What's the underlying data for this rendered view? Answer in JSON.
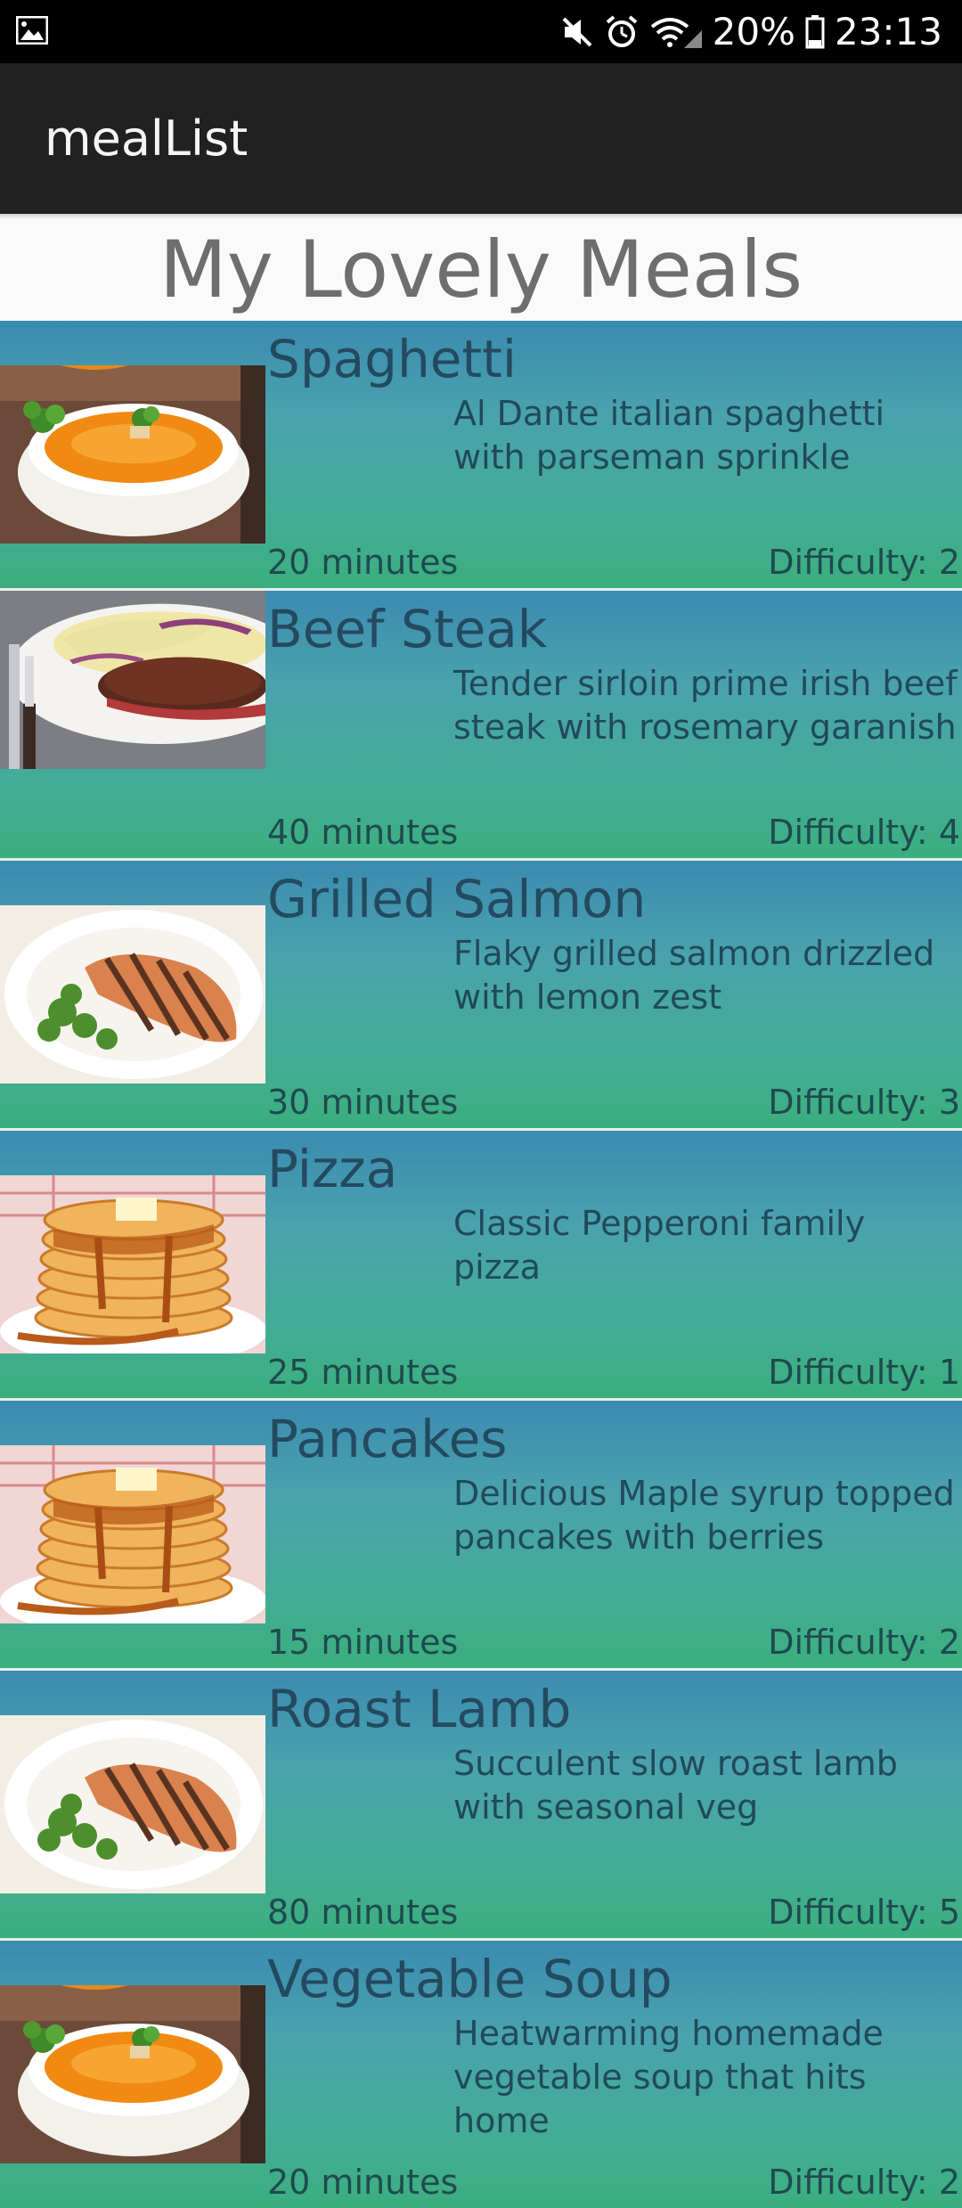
{
  "status_bar": {
    "battery": "20%",
    "time": "23:13",
    "icons": [
      "image-notification-icon",
      "mute-icon",
      "alarm-icon",
      "wifi-icon",
      "signal-icon",
      "battery-icon"
    ]
  },
  "app_bar": {
    "title": "mealList"
  },
  "heading": "My Lovely Meals",
  "colors": {
    "app_bar": "#212121",
    "row_top": "#3a8bb0",
    "row_bottom": "#3aae7e",
    "heading": "#6e6e6e"
  },
  "meals": [
    {
      "name": "Spaghetti",
      "description": "Al Dante italian spaghetti with parseman sprinkle",
      "time": "20 minutes",
      "difficulty": "Difficulty: 2",
      "image": "soup-image"
    },
    {
      "name": "Beef Steak",
      "description": "Tender sirloin prime irish beef steak with rosemary garanish",
      "time": "40 minutes",
      "difficulty": "Difficulty: 4",
      "image": "steak-image"
    },
    {
      "name": "Grilled Salmon",
      "description": "Flaky grilled salmon drizzled with lemon zest",
      "time": "30 minutes",
      "difficulty": "Difficulty: 3",
      "image": "salmon-image"
    },
    {
      "name": "Pizza",
      "description": "Classic Pepperoni family pizza",
      "time": "25 minutes",
      "difficulty": "Difficulty: 1",
      "image": "pancakes-image"
    },
    {
      "name": "Pancakes",
      "description": "Delicious Maple syrup topped pancakes with berries",
      "time": "15 minutes",
      "difficulty": "Difficulty: 2",
      "image": "pancakes-image"
    },
    {
      "name": "Roast Lamb",
      "description": "Succulent slow roast lamb with seasonal veg",
      "time": "80 minutes",
      "difficulty": "Difficulty: 5",
      "image": "salmon-image"
    },
    {
      "name": "Vegetable Soup",
      "description": "Heatwarming homemade vegetable soup that hits home",
      "time": "20 minutes",
      "difficulty": "Difficulty: 2",
      "image": "soup-image"
    }
  ]
}
